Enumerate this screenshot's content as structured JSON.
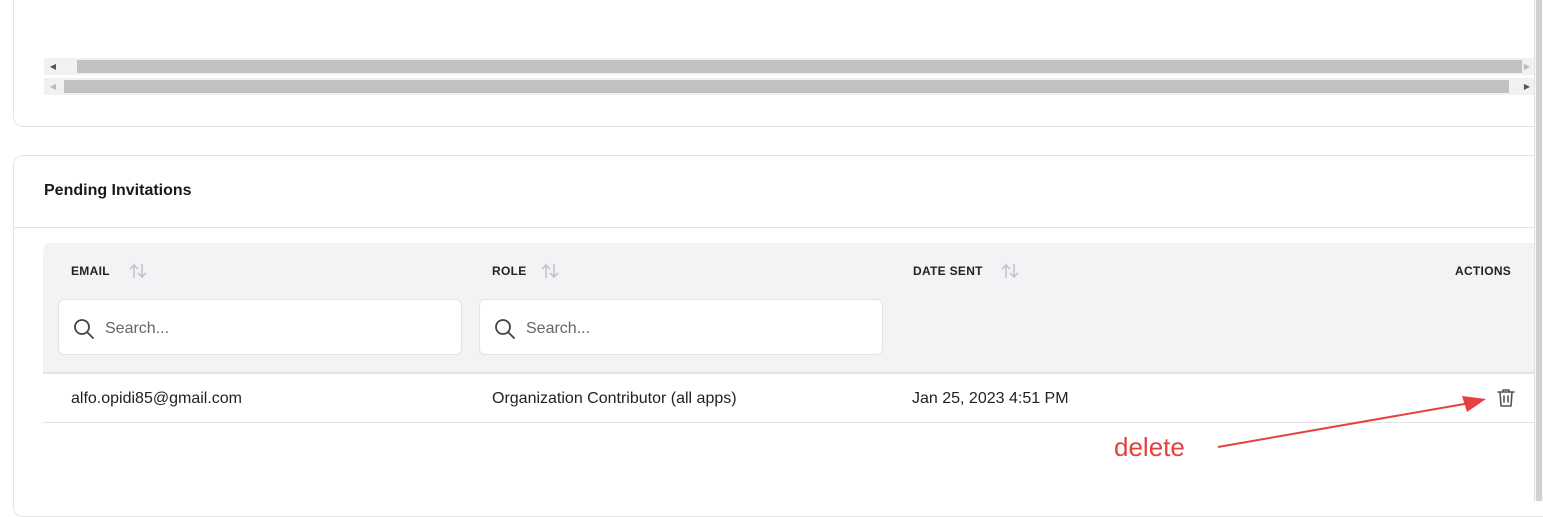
{
  "pending_invitations": {
    "title": "Pending Invitations",
    "columns": {
      "email": "EMAIL",
      "role": "ROLE",
      "date_sent": "DATE SENT",
      "actions": "ACTIONS"
    },
    "email_search_placeholder": "Search...",
    "role_search_placeholder": "Search...",
    "rows": [
      {
        "email": "alfo.opidi85@gmail.com",
        "role": "Organization Contributor (all apps)",
        "date_sent": "Jan 25, 2023 4:51 PM",
        "action_icon": "trash-icon"
      }
    ]
  },
  "annotation": {
    "text": "delete",
    "color": "#e5423f"
  },
  "icons": {
    "sort": "sort-arrows-icon",
    "search": "search-icon",
    "delete": "trash-icon"
  }
}
